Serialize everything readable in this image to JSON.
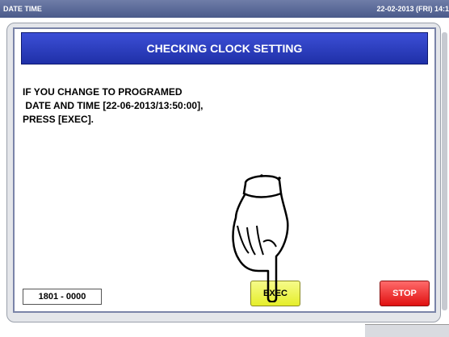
{
  "window": {
    "title": "DATE TIME",
    "datetime": "22-02-2013 (FRI) 14:1"
  },
  "dialog": {
    "title": "CHECKING CLOCK SETTING",
    "message_lines": [
      "IF YOU CHANGE TO PROGRAMED",
      " DATE AND TIME [22-06-2013/13:50:00],",
      "PRESS [EXEC]."
    ],
    "code": "1801 - 0000",
    "exec_label": "EXEC",
    "stop_label": "STOP"
  },
  "colors": {
    "header_blue": "#2a3bc4",
    "exec_yellow": "#e9f03a",
    "stop_red": "#f03030"
  },
  "icons": {
    "pointer": "pointing-hand-icon"
  }
}
